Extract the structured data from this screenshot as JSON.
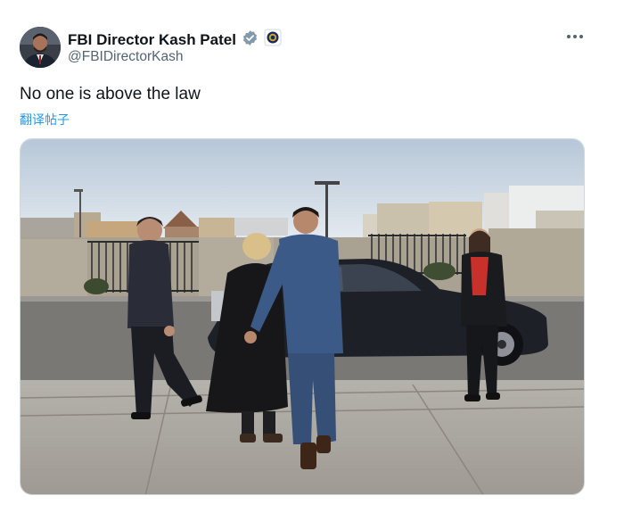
{
  "tweet": {
    "display_name": "FBI Director Kash Patel",
    "handle": "@FBIDirectorKash",
    "text": "No one is above the law",
    "translate_label": "翻译帖子",
    "verified_icon": "verified-badge-icon",
    "affiliation_icon": "fbi-seal-icon",
    "more_icon": "more-options-icon"
  },
  "colors": {
    "text_primary": "#0f1419",
    "text_secondary": "#536471",
    "link": "#1d9bf0",
    "verified": "#829aab"
  }
}
